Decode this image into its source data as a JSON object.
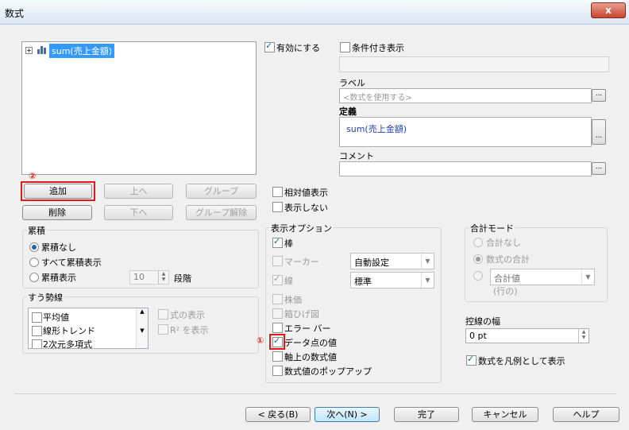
{
  "window": {
    "title": "数式",
    "close": "x"
  },
  "tree": {
    "expander": "+",
    "item": "sum(売上金額)"
  },
  "top_right": {
    "enable_label": "有効にする",
    "conditional_label": "条件付き表示",
    "label_label": "ラベル",
    "label_placeholder": "<数式を使用する>",
    "definition_label": "定義",
    "definition_value": "sum(売上金額)",
    "comment_label": "コメント",
    "ellipsis": "..."
  },
  "buttons": {
    "add": "追加",
    "up": "上へ",
    "group": "グループ",
    "delete": "削除",
    "down": "下へ",
    "ungroup": "グループ解除"
  },
  "middle": {
    "relative": "相対値表示",
    "hide": "表示しない"
  },
  "accumulation": {
    "title": "累積",
    "none": "累積なし",
    "all": "すべて累積表示",
    "steps": "累積表示",
    "steps_value": "10",
    "steps_label": "段階"
  },
  "trend": {
    "title": "すう勢線",
    "items": [
      "平均値",
      "線形トレンド",
      "2次元多項式"
    ],
    "show_formula": "式の表示",
    "show_r2": "R² を表示"
  },
  "display": {
    "title": "表示オプション",
    "bar": "棒",
    "marker": "マーカー",
    "marker_combo": "自動設定",
    "line": "線",
    "line_combo": "標準",
    "stock": "株価",
    "box": "箱ひげ図",
    "error": "エラー バー",
    "values": "データ点の値",
    "axis_values": "軸上の数式値",
    "popup": "数式値のポップアップ"
  },
  "total": {
    "title": "合計モード",
    "none": "合計なし",
    "sum": "数式の合計",
    "combo": "合計値",
    "row": "(行の)"
  },
  "stroke": {
    "label": "控線の幅",
    "value": "0 pt"
  },
  "legend": {
    "label": "数式を凡例として表示"
  },
  "annotations": {
    "one": "①",
    "two": "②"
  },
  "footer": {
    "back": "< 戻る(B)",
    "next": "次へ(N) >",
    "finish": "完了",
    "cancel": "キャンセル",
    "help": "ヘルプ"
  }
}
